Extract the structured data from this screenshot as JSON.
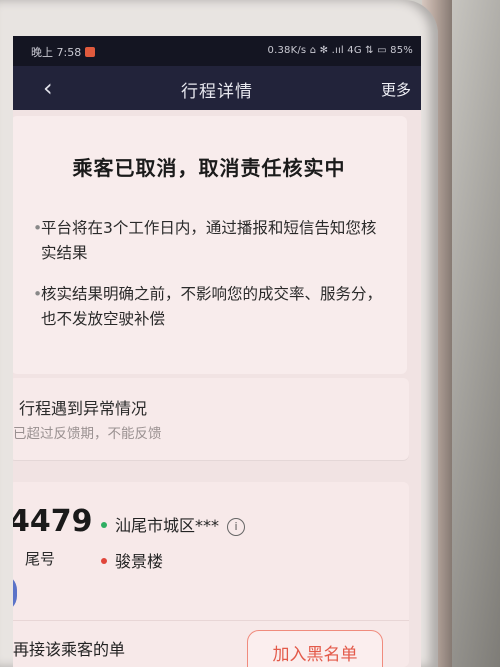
{
  "status_bar": {
    "time": "晚上 7:58",
    "indicators": "0.38K/s ⌂ ✻ .ııl 4G ⇅ ▭ 85%",
    "app_badge_color": "#e05a3d"
  },
  "header": {
    "back_icon": "chevron-left-icon",
    "title": "行程详情",
    "more_label": "更多",
    "background": "#22233a"
  },
  "cancel_card": {
    "heading": "乘客已取消，取消责任核实中",
    "bullets": [
      "平台将在3个工作日内，通过播报和短信告知您核实结果",
      "核实结果明确之前，不影响您的成交率、服务分，也不发放空驶补偿"
    ]
  },
  "abnormal_card": {
    "title": "行程遇到异常情况",
    "subtitle": "已超过反馈期，不能反馈"
  },
  "passenger_card": {
    "plate": "4479",
    "plate_sub": "尾号",
    "origin": "汕尾市城区***",
    "origin_dot_color": "#2fae62",
    "destination": "骏景楼",
    "destination_dot_color": "#e0453a",
    "info_icon": "info-icon",
    "footer_text": "再接该乘客的单",
    "blacklist_label": "加入黑名单",
    "accent": "#e35a4a"
  }
}
